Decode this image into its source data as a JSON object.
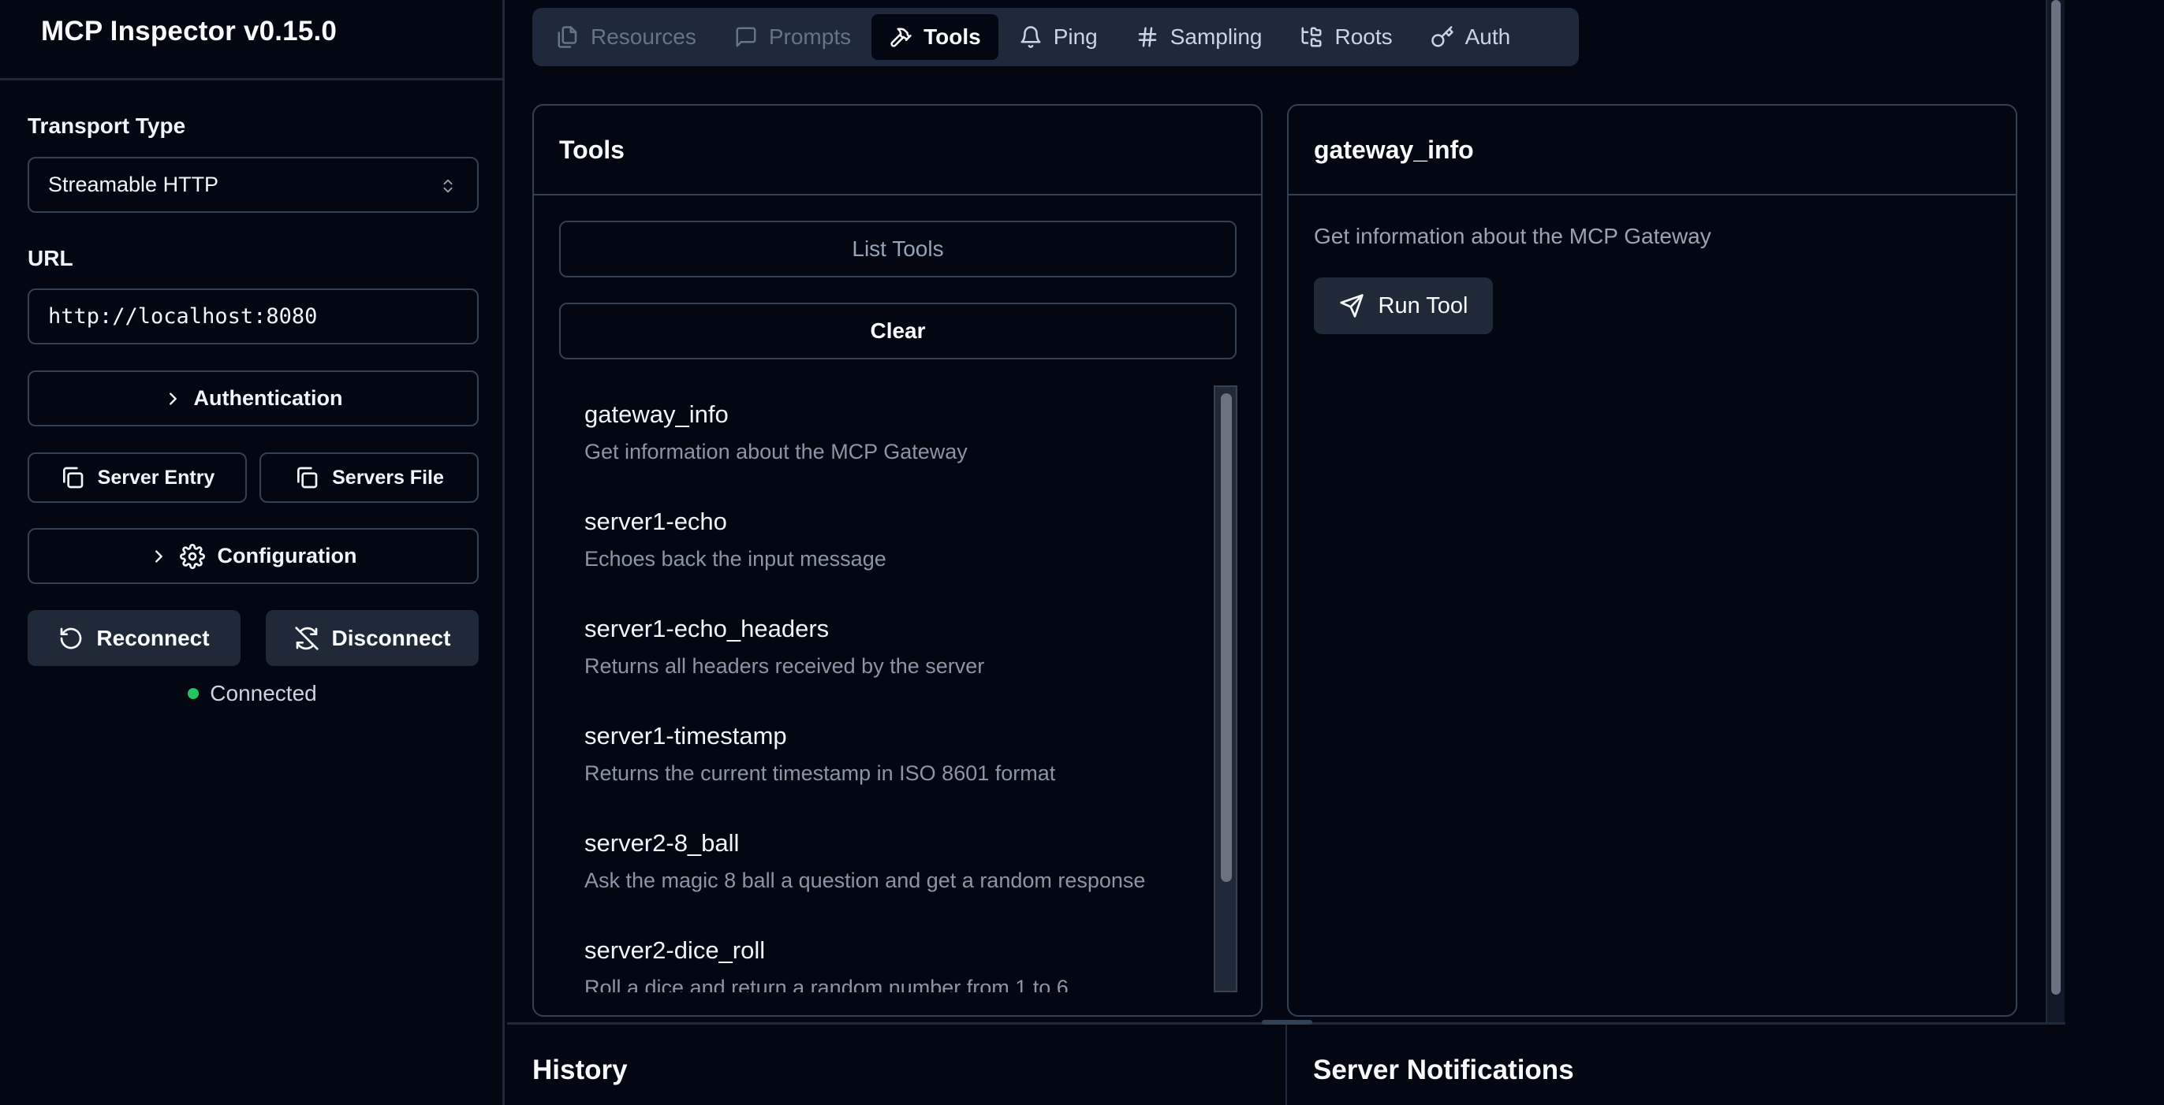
{
  "app": {
    "title": "MCP Inspector v0.15.0"
  },
  "sidebar": {
    "transport_label": "Transport Type",
    "transport_value": "Streamable HTTP",
    "url_label": "URL",
    "url_value": "http://localhost:8080",
    "authentication_label": "Authentication",
    "server_entry_label": "Server Entry",
    "servers_file_label": "Servers File",
    "configuration_label": "Configuration",
    "reconnect_label": "Reconnect",
    "disconnect_label": "Disconnect",
    "status_text": "Connected",
    "status_color": "#22c55e"
  },
  "tabs": [
    {
      "label": "Resources",
      "icon": "files-icon",
      "active": false
    },
    {
      "label": "Prompts",
      "icon": "message-square-icon",
      "active": false
    },
    {
      "label": "Tools",
      "icon": "hammer-icon",
      "active": true
    },
    {
      "label": "Ping",
      "icon": "bell-icon",
      "active": false
    },
    {
      "label": "Sampling",
      "icon": "hash-icon",
      "active": false
    },
    {
      "label": "Roots",
      "icon": "folder-tree-icon",
      "active": false
    },
    {
      "label": "Auth",
      "icon": "key-icon",
      "active": false
    }
  ],
  "tools_panel": {
    "title": "Tools",
    "list_tools_label": "List Tools",
    "clear_label": "Clear",
    "items": [
      {
        "name": "gateway_info",
        "description": "Get information about the MCP Gateway"
      },
      {
        "name": "server1-echo",
        "description": "Echoes back the input message"
      },
      {
        "name": "server1-echo_headers",
        "description": "Returns all headers received by the server"
      },
      {
        "name": "server1-timestamp",
        "description": "Returns the current timestamp in ISO 8601 format"
      },
      {
        "name": "server2-8_ball",
        "description": "Ask the magic 8 ball a question and get a random response"
      },
      {
        "name": "server2-dice_roll",
        "description": "Roll a dice and return a random number from 1 to 6"
      }
    ]
  },
  "detail_panel": {
    "title": "gateway_info",
    "description": "Get information about the MCP Gateway",
    "run_label": "Run Tool"
  },
  "bottom": {
    "history_title": "History",
    "notifications_title": "Server Notifications"
  }
}
